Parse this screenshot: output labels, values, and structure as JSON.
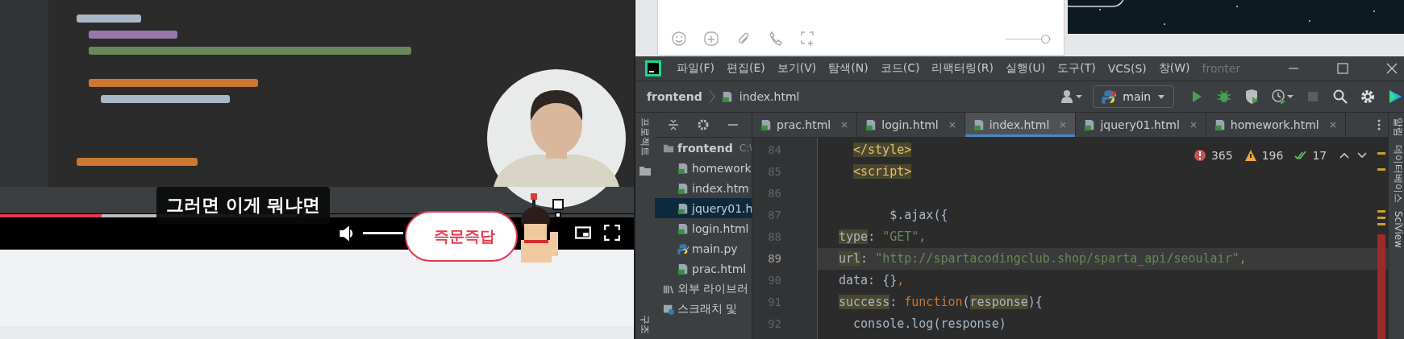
{
  "video_player": {
    "subtitle": "그러면 이게 뭐냐면",
    "progress": {
      "level": 0.16
    },
    "volume": {
      "level": 1.0
    },
    "quick_answer": "즉문즉답"
  },
  "chat_window": {
    "zoom_slider": {
      "level": 0.9
    }
  },
  "ide": {
    "menu": [
      "파일(F)",
      "편집(E)",
      "보기(V)",
      "탐색(N)",
      "코드(C)",
      "리팩터링(R)",
      "실행(U)",
      "도구(T)",
      "VCS(S)",
      "창(W)"
    ],
    "title": "fronter",
    "breadcrumb": [
      "frontend",
      "index.html"
    ],
    "run_config": "main",
    "left_strip": [
      "프로젝트",
      "구조"
    ],
    "right_strip": [
      "알림",
      "데이터베이스",
      "SciView"
    ],
    "project_tree": [
      {
        "label": "frontend",
        "path": "C:\\",
        "kind": "folder",
        "selected": false,
        "children": [
          {
            "label": "homework",
            "kind": "html",
            "selected": false
          },
          {
            "label": "index.htm",
            "kind": "html",
            "selected": false
          },
          {
            "label": "jquery01.h",
            "kind": "html",
            "selected": true
          },
          {
            "label": "login.html",
            "kind": "html",
            "selected": false
          },
          {
            "label": "main.py",
            "kind": "python",
            "selected": false
          },
          {
            "label": "prac.html",
            "kind": "html",
            "selected": false
          }
        ]
      },
      {
        "label": "외부 라이브러",
        "kind": "library",
        "selected": false
      },
      {
        "label": "스크래치 및",
        "kind": "scratch",
        "selected": false
      }
    ],
    "tabs": [
      {
        "label": "prac.html",
        "selected": false
      },
      {
        "label": "login.html",
        "selected": false
      },
      {
        "label": "index.html",
        "selected": true
      },
      {
        "label": "jquery01.html",
        "selected": false
      },
      {
        "label": "homework.html",
        "selected": false
      }
    ],
    "inspections": {
      "errors": "365",
      "warnings": "196",
      "weak_warnings": "17"
    },
    "lines": [
      {
        "number": "84",
        "current": false,
        "kind": "indented",
        "segments": [
          {
            "kind": "tagmark",
            "text": "</style>"
          }
        ]
      },
      {
        "number": "85",
        "current": false,
        "kind": "indented",
        "segments": [
          {
            "kind": "tagmark",
            "text": "<script>"
          }
        ]
      },
      {
        "number": "86",
        "current": false,
        "kind": "flat"
      },
      {
        "number": "87",
        "current": false,
        "kind": "flat",
        "segments": [
          {
            "kind": "plain",
            "text": "       $.ajax({"
          }
        ]
      },
      {
        "number": "88",
        "current": false,
        "kind": "flat",
        "segments": [
          {
            "kind": "mark",
            "text": "type"
          },
          {
            "kind": "plain",
            "text": ": "
          },
          {
            "kind": "string",
            "text": "\"GET\""
          },
          {
            "kind": "keyword",
            "text": ","
          }
        ]
      },
      {
        "number": "89",
        "current": true,
        "kind": "flat",
        "segments": [
          {
            "kind": "mark",
            "text": "url"
          },
          {
            "kind": "plain",
            "text": ": "
          },
          {
            "kind": "string",
            "text": "\"http://spartacodingclub.shop/sparta_api/seoulair\""
          },
          {
            "kind": "keyword",
            "text": ","
          }
        ]
      },
      {
        "number": "90",
        "current": false,
        "kind": "flat",
        "segments": [
          {
            "kind": "plain",
            "text": "data: {}"
          },
          {
            "kind": "keyword",
            "text": ","
          }
        ]
      },
      {
        "number": "91",
        "current": false,
        "kind": "flat",
        "segments": [
          {
            "kind": "mark",
            "text": "success"
          },
          {
            "kind": "plain",
            "text": ": "
          },
          {
            "kind": "keyword",
            "text": "function"
          },
          {
            "kind": "plain",
            "text": "("
          },
          {
            "kind": "mark",
            "text": "response"
          },
          {
            "kind": "plain",
            "text": "){"
          }
        ]
      },
      {
        "number": "92",
        "current": false,
        "kind": "flat",
        "segments": [
          {
            "kind": "plain",
            "text": "  console.log(response)"
          }
        ]
      }
    ]
  }
}
